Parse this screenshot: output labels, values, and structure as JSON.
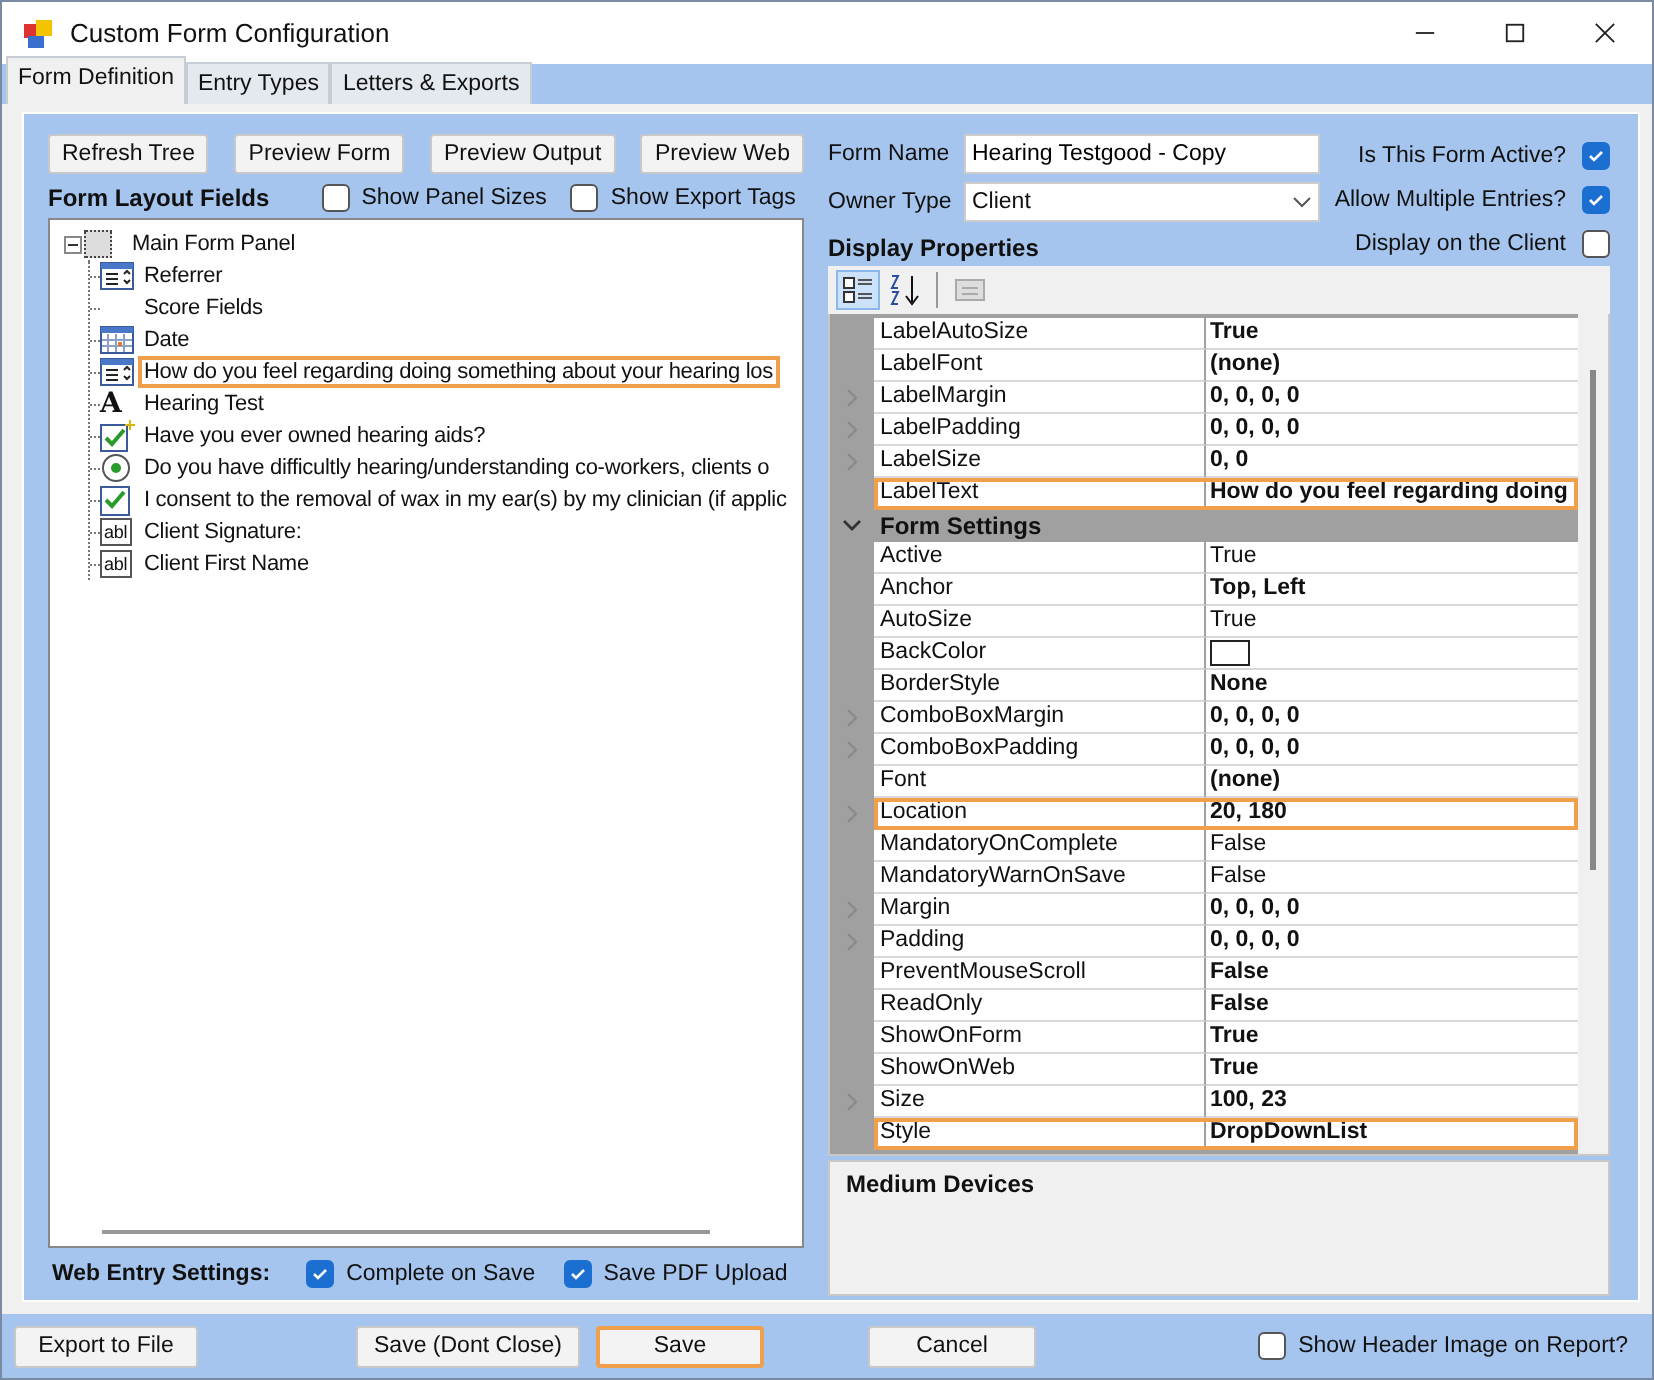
{
  "window": {
    "title": "Custom Form Configuration"
  },
  "tabs": [
    {
      "label": "Form Definition",
      "selected": true
    },
    {
      "label": "Entry Types",
      "selected": false
    },
    {
      "label": "Letters & Exports",
      "selected": false
    }
  ],
  "toolbar_buttons": [
    "Refresh Tree",
    "Preview Form",
    "Preview Output",
    "Preview Web"
  ],
  "layout_fields": {
    "title": "Form Layout Fields",
    "options": [
      {
        "label": "Show Panel Sizes",
        "checked": false
      },
      {
        "label": "Show Export Tags",
        "checked": false
      }
    ],
    "tree": [
      {
        "label": "Main Form Panel",
        "kind": "panel",
        "expanded": true,
        "selected": false,
        "children": [
          {
            "label": "Referrer",
            "kind": "list",
            "selected": false
          },
          {
            "label": "Score Fields",
            "kind": "none",
            "selected": false
          },
          {
            "label": "Date",
            "kind": "calendar",
            "selected": false
          },
          {
            "label": "How do you feel regarding doing something about your hearing los",
            "kind": "list",
            "selected": true
          },
          {
            "label": "Hearing Test",
            "kind": "letter",
            "icon": "A",
            "selected": false
          },
          {
            "label": "Have you ever owned hearing aids?",
            "kind": "checkplus",
            "selected": false
          },
          {
            "label": "Do you have difficultly hearing/understanding co-workers, clients o",
            "kind": "radio",
            "selected": false
          },
          {
            "label": "I consent to the removal of wax in my ear(s) by my clinician (if applic",
            "kind": "check",
            "selected": false
          },
          {
            "label": "Client Signature:",
            "kind": "textbox",
            "icon": "abl",
            "selected": false
          },
          {
            "label": "Client First Name",
            "kind": "textbox",
            "icon": "abl",
            "selected": false
          }
        ]
      }
    ]
  },
  "web_entry": {
    "title": "Web Entry Settings:",
    "options": [
      {
        "label": "Complete on Save",
        "checked": true
      },
      {
        "label": "Save PDF Upload",
        "checked": true
      }
    ]
  },
  "form_name": {
    "label": "Form Name",
    "value": "Hearing Testgood - Copy"
  },
  "owner_type": {
    "label": "Owner Type",
    "value": "Client"
  },
  "flags": [
    {
      "label": "Is This Form Active?",
      "checked": true
    },
    {
      "label": "Allow Multiple Entries?",
      "checked": true
    },
    {
      "label": "Display on the Client",
      "checked": false
    }
  ],
  "display_properties": {
    "title": "Display Properties",
    "rows": [
      {
        "kind": "prop",
        "name": "LabelAutoSize",
        "value": "True",
        "bold": true,
        "expandable": false,
        "selected": false
      },
      {
        "kind": "prop",
        "name": "LabelFont",
        "value": "(none)",
        "bold": true,
        "expandable": false,
        "selected": false
      },
      {
        "kind": "prop",
        "name": "LabelMargin",
        "value": "0, 0, 0, 0",
        "bold": true,
        "expandable": true,
        "selected": false
      },
      {
        "kind": "prop",
        "name": "LabelPadding",
        "value": "0, 0, 0, 0",
        "bold": true,
        "expandable": true,
        "selected": false
      },
      {
        "kind": "prop",
        "name": "LabelSize",
        "value": "0, 0",
        "bold": true,
        "expandable": true,
        "selected": false
      },
      {
        "kind": "prop",
        "name": "LabelText",
        "value": "How do you feel regarding doing",
        "bold": true,
        "expandable": false,
        "selected": true
      },
      {
        "kind": "category",
        "name": "Form Settings",
        "expanded": true
      },
      {
        "kind": "prop",
        "name": "Active",
        "value": "True",
        "bold": false,
        "expandable": false,
        "selected": false
      },
      {
        "kind": "prop",
        "name": "Anchor",
        "value": "Top, Left",
        "bold": true,
        "expandable": false,
        "selected": false
      },
      {
        "kind": "prop",
        "name": "AutoSize",
        "value": "True",
        "bold": false,
        "expandable": false,
        "selected": false
      },
      {
        "kind": "color",
        "name": "BackColor",
        "color": "#ffffff",
        "expandable": false,
        "selected": false
      },
      {
        "kind": "prop",
        "name": "BorderStyle",
        "value": "None",
        "bold": true,
        "expandable": false,
        "selected": false
      },
      {
        "kind": "prop",
        "name": "ComboBoxMargin",
        "value": "0, 0, 0, 0",
        "bold": true,
        "expandable": true,
        "selected": false
      },
      {
        "kind": "prop",
        "name": "ComboBoxPadding",
        "value": "0, 0, 0, 0",
        "bold": true,
        "expandable": true,
        "selected": false
      },
      {
        "kind": "prop",
        "name": "Font",
        "value": "(none)",
        "bold": true,
        "expandable": false,
        "selected": false
      },
      {
        "kind": "prop",
        "name": "Location",
        "value": "20, 180",
        "bold": true,
        "expandable": true,
        "selected": true
      },
      {
        "kind": "prop",
        "name": "MandatoryOnComplete",
        "value": "False",
        "bold": false,
        "expandable": false,
        "selected": false
      },
      {
        "kind": "prop",
        "name": "MandatoryWarnOnSave",
        "value": "False",
        "bold": false,
        "expandable": false,
        "selected": false
      },
      {
        "kind": "prop",
        "name": "Margin",
        "value": "0, 0, 0, 0",
        "bold": true,
        "expandable": true,
        "selected": false
      },
      {
        "kind": "prop",
        "name": "Padding",
        "value": "0, 0, 0, 0",
        "bold": true,
        "expandable": true,
        "selected": false
      },
      {
        "kind": "prop",
        "name": "PreventMouseScroll",
        "value": "False",
        "bold": true,
        "expandable": false,
        "selected": false
      },
      {
        "kind": "prop",
        "name": "ReadOnly",
        "value": "False",
        "bold": true,
        "expandable": false,
        "selected": false
      },
      {
        "kind": "prop",
        "name": "ShowOnForm",
        "value": "True",
        "bold": true,
        "expandable": false,
        "selected": false
      },
      {
        "kind": "prop",
        "name": "ShowOnWeb",
        "value": "True",
        "bold": true,
        "expandable": false,
        "selected": false
      },
      {
        "kind": "prop",
        "name": "Size",
        "value": "100, 23",
        "bold": true,
        "expandable": true,
        "selected": false
      },
      {
        "kind": "prop",
        "name": "Style",
        "value": "DropDownList",
        "bold": true,
        "expandable": false,
        "selected": true
      }
    ],
    "description": "Medium Devices"
  },
  "footer": {
    "buttons": [
      {
        "label": "Export to File",
        "selected": false
      },
      {
        "label": "Save (Dont Close)",
        "selected": false
      },
      {
        "label": "Save",
        "selected": true
      },
      {
        "label": "Cancel",
        "selected": false
      }
    ],
    "option": {
      "label": "Show Header Image on Report?",
      "checked": false
    }
  }
}
